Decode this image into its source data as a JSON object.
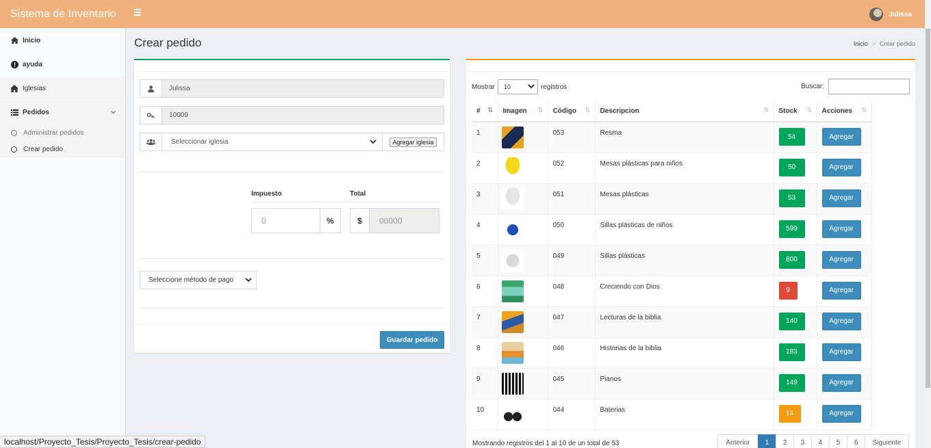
{
  "app": {
    "title": "Sistema de Inventario"
  },
  "header": {
    "user_name": "Julissa"
  },
  "sidebar": {
    "items": [
      {
        "label": "Inicio",
        "icon": "dashboard-icon"
      },
      {
        "label": "ayuda",
        "icon": "info-circle-icon"
      },
      {
        "label": "Iglesias",
        "icon": "home-icon"
      },
      {
        "label": "Pedidos",
        "icon": "list-icon"
      }
    ],
    "subitems": [
      {
        "label": "Administrar pedidos"
      },
      {
        "label": "Crear pedido"
      }
    ]
  },
  "page": {
    "title": "Crear pedido"
  },
  "breadcrumb": {
    "home": "Inicio",
    "current": "Crear pedido"
  },
  "form": {
    "user": "Julissa",
    "code": "10009",
    "church_select": "Seleccionar iglesia",
    "add_church_button": "Agregar iglesia",
    "tax_label": "Impuesto",
    "total_label": "Total",
    "tax_value": "0",
    "tax_unit": "%",
    "total_unit": "$",
    "total_value": "00000",
    "payment_select": "Seleccione método de pago",
    "save_button": "Guardar pedido"
  },
  "table": {
    "show_label": "Mostrar",
    "length_value": "10",
    "records_label": "registros",
    "search_label": "Buscar:",
    "columns": [
      "#",
      "Imagen",
      "Código",
      "Descripcion",
      "Stock",
      "Acciones"
    ],
    "rows": [
      {
        "n": "1",
        "code": "053",
        "desc": "Resma",
        "stock": "54",
        "stock_color": "green",
        "action": "Agregar"
      },
      {
        "n": "2",
        "code": "052",
        "desc": "Mesas plásticas para niños",
        "stock": "50",
        "stock_color": "green",
        "action": "Agregar"
      },
      {
        "n": "3",
        "code": "051",
        "desc": "Mesas plásticas",
        "stock": "53",
        "stock_color": "green",
        "action": "Agregar"
      },
      {
        "n": "4",
        "code": "050",
        "desc": "Sillas plásticas de niños",
        "stock": "599",
        "stock_color": "green",
        "action": "Agregar"
      },
      {
        "n": "5",
        "code": "049",
        "desc": "Sillas plásticas",
        "stock": "800",
        "stock_color": "green",
        "action": "Agregar"
      },
      {
        "n": "6",
        "code": "048",
        "desc": "Creciendo con Dios",
        "stock": "9",
        "stock_color": "red",
        "action": "Agregar"
      },
      {
        "n": "7",
        "code": "047",
        "desc": "Lecturas de la biblia",
        "stock": "140",
        "stock_color": "green",
        "action": "Agregar"
      },
      {
        "n": "8",
        "code": "046",
        "desc": "Historias de la biblia",
        "stock": "183",
        "stock_color": "green",
        "action": "Agregar"
      },
      {
        "n": "9",
        "code": "045",
        "desc": "Pianos",
        "stock": "149",
        "stock_color": "green",
        "action": "Agregar"
      },
      {
        "n": "10",
        "code": "044",
        "desc": "Baterias",
        "stock": "14",
        "stock_color": "orange",
        "action": "Agregar"
      }
    ],
    "info": "Mostrando registros del 1 al 10 de un total de 53",
    "pagination": [
      "Anterior",
      "1",
      "2",
      "3",
      "4",
      "5",
      "6",
      "Siguiente"
    ]
  },
  "statusbar": {
    "url": "localhost/Proyecto_Tesis/Proyecto_Tesis/crear-pedido"
  },
  "colors": {
    "header": "#f0b27a",
    "primary": "#3c8dbc",
    "success": "#00a65a",
    "danger": "#dd4b39",
    "warning": "#f39c12"
  }
}
